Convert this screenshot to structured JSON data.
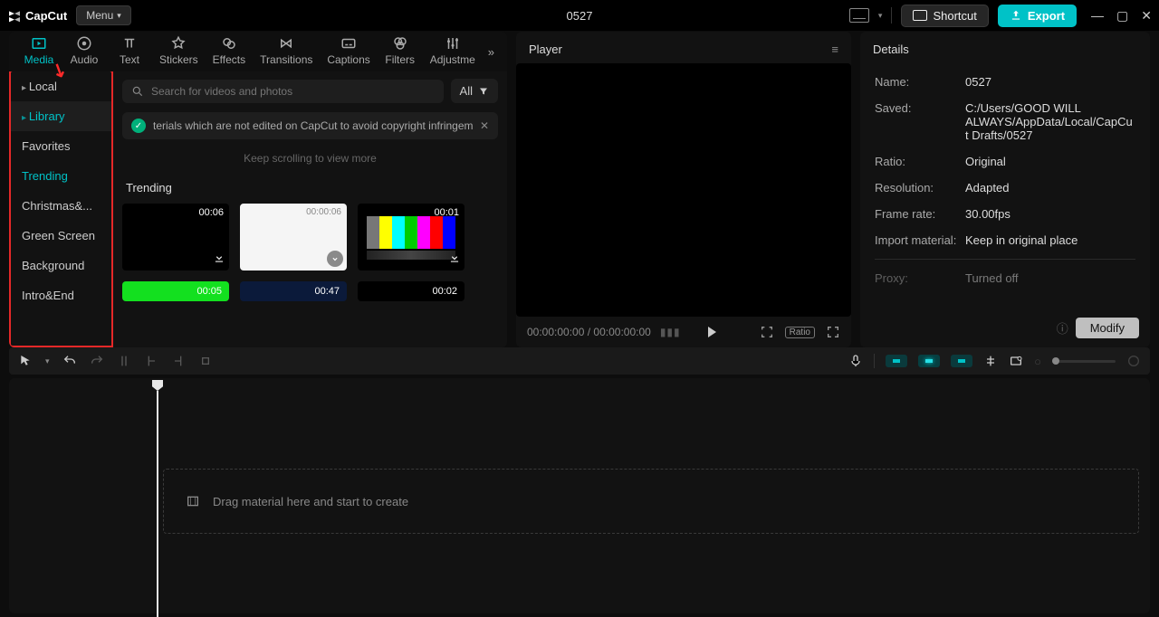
{
  "titlebar": {
    "app": "CapCut",
    "menu": "Menu",
    "project": "0527",
    "shortcut": "Shortcut",
    "export": "Export"
  },
  "tabs": [
    "Media",
    "Audio",
    "Text",
    "Stickers",
    "Effects",
    "Transitions",
    "Captions",
    "Filters",
    "Adjustme"
  ],
  "sidebar": {
    "local": "Local",
    "library": "Library",
    "items": [
      "Favorites",
      "Trending",
      "Christmas&...",
      "Green Screen",
      "Background",
      "Intro&End"
    ]
  },
  "search": {
    "placeholder": "Search for videos and photos",
    "all": "All"
  },
  "notice": "terials which are not edited on CapCut to avoid copyright infringem",
  "scroll_hint": "Keep scrolling to view more",
  "section": "Trending",
  "clips": [
    {
      "dur": "00:06"
    },
    {
      "dur": "00:00:06"
    },
    {
      "dur": "00:01"
    }
  ],
  "clips2": [
    {
      "dur": "00:05"
    },
    {
      "dur": "00:47"
    },
    {
      "dur": "00:02"
    }
  ],
  "player": {
    "title": "Player",
    "time": "00:00:00:00",
    "total": "00:00:00:00",
    "ratio": "Ratio"
  },
  "details": {
    "title": "Details",
    "rows": {
      "name": {
        "k": "Name:",
        "v": "0527"
      },
      "saved": {
        "k": "Saved:",
        "v": "C:/Users/GOOD WILL ALWAYS/AppData/Local/CapCut Drafts/0527"
      },
      "ratio": {
        "k": "Ratio:",
        "v": "Original"
      },
      "resolution": {
        "k": "Resolution:",
        "v": "Adapted"
      },
      "framerate": {
        "k": "Frame rate:",
        "v": "30.00fps"
      },
      "import": {
        "k": "Import material:",
        "v": "Keep in original place"
      },
      "proxy": {
        "k": "Proxy:",
        "v": "Turned off"
      }
    },
    "modify": "Modify"
  },
  "timeline": {
    "drop": "Drag material here and start to create"
  }
}
